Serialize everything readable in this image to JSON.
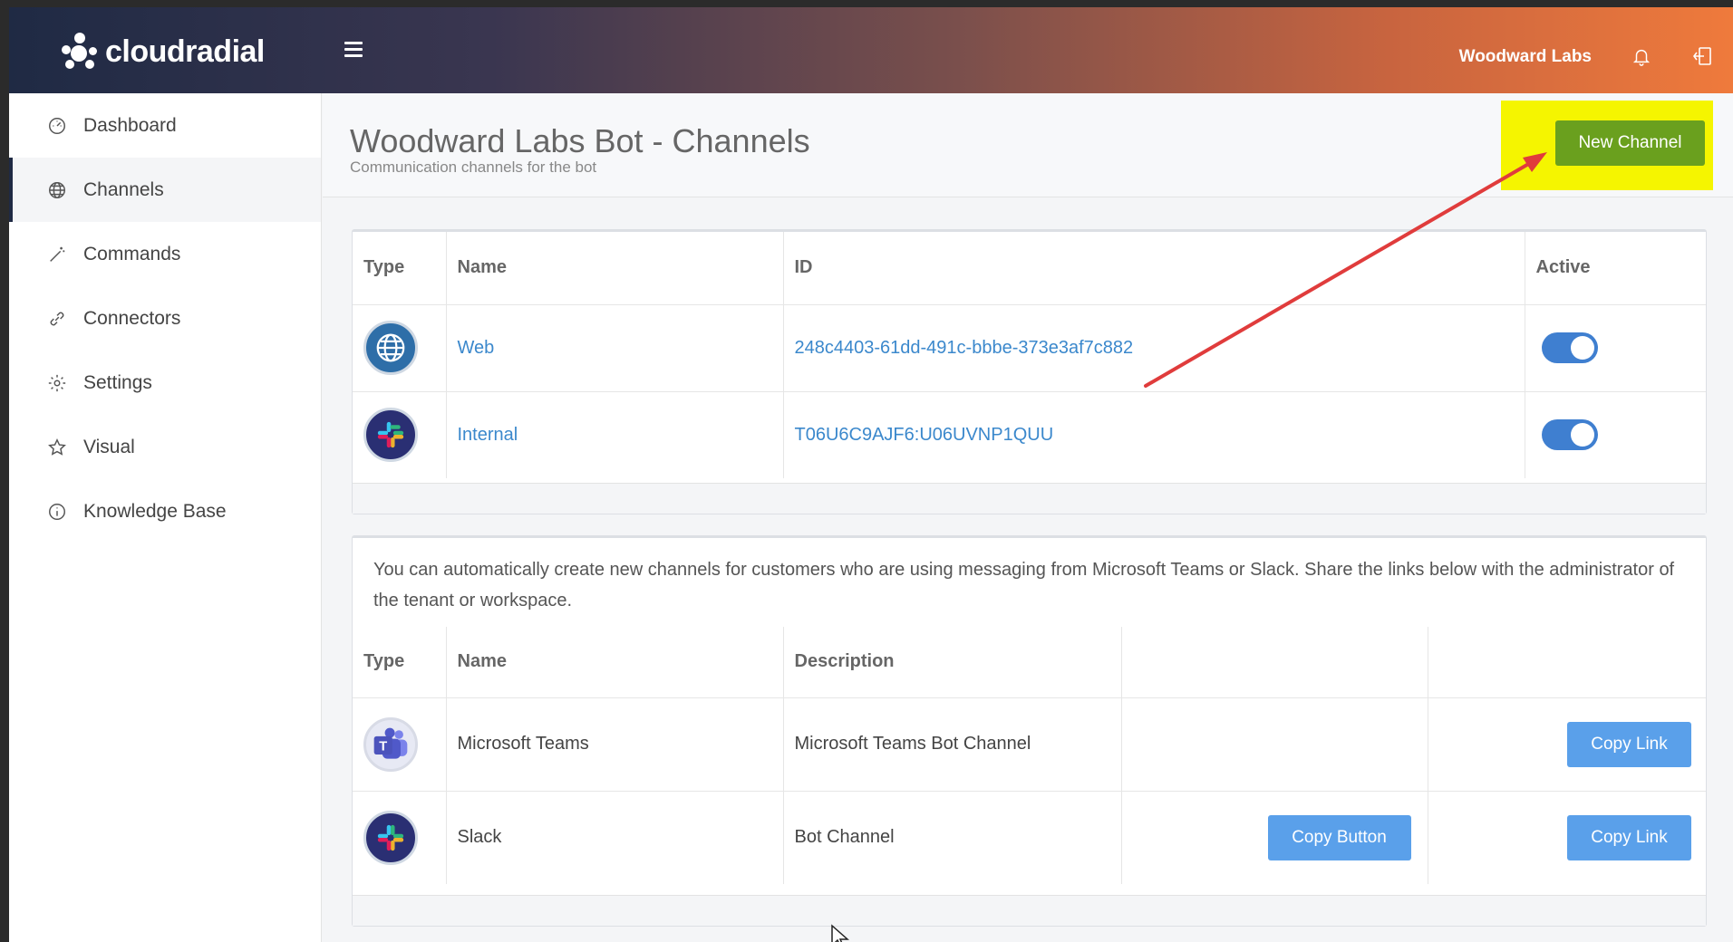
{
  "brand": {
    "logo_text": "cloudradial"
  },
  "topbar": {
    "org_name": "Woodward Labs"
  },
  "sidebar": {
    "items": [
      {
        "label": "Dashboard",
        "icon": "dashboard-icon",
        "active": false
      },
      {
        "label": "Channels",
        "icon": "globe-icon",
        "active": true
      },
      {
        "label": "Commands",
        "icon": "magic-wand-icon",
        "active": false
      },
      {
        "label": "Connectors",
        "icon": "link-icon",
        "active": false
      },
      {
        "label": "Settings",
        "icon": "gear-icon",
        "active": false
      },
      {
        "label": "Visual",
        "icon": "star-icon",
        "active": false
      },
      {
        "label": "Knowledge Base",
        "icon": "info-icon",
        "active": false
      }
    ]
  },
  "header": {
    "title": "Woodward Labs Bot - Channels",
    "subtitle": "Communication channels for the bot",
    "new_channel_label": "New Channel"
  },
  "channels_table": {
    "columns": [
      "Type",
      "Name",
      "ID",
      "Active"
    ],
    "rows": [
      {
        "type_icon": "web-globe-icon",
        "name": "Web",
        "id": "248c4403-61dd-491c-bbbe-373e3af7c882",
        "active": true
      },
      {
        "type_icon": "slack-icon",
        "name": "Internal",
        "id": "T06U6C9AJF6:U06UVNP1QUU",
        "active": true
      }
    ]
  },
  "auto_channels": {
    "info": "You can automatically create new channels for customers who are using messaging from Microsoft Teams or Slack. Share the links below with the administrator of the tenant or workspace.",
    "columns": [
      "Type",
      "Name",
      "Description",
      "",
      ""
    ],
    "rows": [
      {
        "type_icon": "teams-icon",
        "name": "Microsoft Teams",
        "description": "Microsoft Teams Bot Channel",
        "copy_button_label": "",
        "copy_link_label": "Copy Link"
      },
      {
        "type_icon": "slack-icon",
        "name": "Slack",
        "description": "Bot Channel",
        "copy_button_label": "Copy Button",
        "copy_link_label": "Copy Link"
      }
    ]
  },
  "colors": {
    "highlight": "#f5f500",
    "new_channel_button": "#6aa01e",
    "primary_button": "#5aa0ea",
    "link": "#3b88cc",
    "annotation_arrow": "#e03c3c"
  }
}
